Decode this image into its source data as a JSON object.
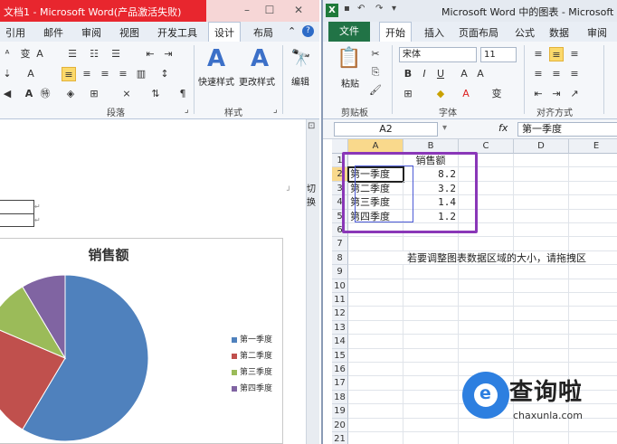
{
  "word": {
    "title": "文档1 - Microsoft Word(产品激活失败)",
    "window_controls": [
      "–",
      "☐",
      "✕"
    ],
    "tabs": [
      "引用",
      "邮件",
      "审阅",
      "视图",
      "开发工具",
      "设计",
      "布局"
    ],
    "active_tab": "设计",
    "ribbon": {
      "groups": [
        "段落",
        "样式"
      ],
      "quick_styles_label": "快速样式",
      "change_styles_label": "更改样式",
      "edit_label": "编辑"
    },
    "document": {
      "side_label": "切换"
    },
    "chart": {
      "title": "销售额",
      "categories": [
        "第一季度",
        "第二季度",
        "第三季度",
        "第四季度"
      ],
      "values": [
        8.2,
        3.2,
        1.4,
        1.2
      ],
      "colors": [
        "#4f81bd",
        "#c0504d",
        "#9bbb59",
        "#8064a2"
      ]
    }
  },
  "excel": {
    "title": "Microsoft Word 中的图表 - Microsoft Ex",
    "tabs": [
      "文件",
      "开始",
      "插入",
      "页面布局",
      "公式",
      "数据",
      "审阅"
    ],
    "active_tab": "开始",
    "ribbon": {
      "paste_label": "粘贴",
      "font_name": "宋体",
      "font_size": "11",
      "group_labels": [
        "剪贴板",
        "字体",
        "对齐方式"
      ]
    },
    "name_box": "A2",
    "fx_label": "fx",
    "formula_value": "第一季度",
    "columns": [
      "A",
      "B",
      "C",
      "D",
      "E"
    ],
    "rows": [
      "1",
      "2",
      "3",
      "4",
      "5",
      "6",
      "7",
      "8",
      "9",
      "10",
      "11",
      "12",
      "13",
      "14",
      "15",
      "16",
      "17",
      "18",
      "19",
      "20",
      "21"
    ],
    "cells": {
      "B1": "销售额",
      "A2": "第一季度",
      "B2": "8.2",
      "A3": "第二季度",
      "B3": "3.2",
      "A4": "第三季度",
      "B4": "1.4",
      "A5": "第四季度",
      "B5": "1.2",
      "A8": "若要调整图表数据区域的大小，请拖拽区"
    }
  },
  "watermark": {
    "brand_cn": "查询啦",
    "brand_url": "chaxunla.com"
  }
}
